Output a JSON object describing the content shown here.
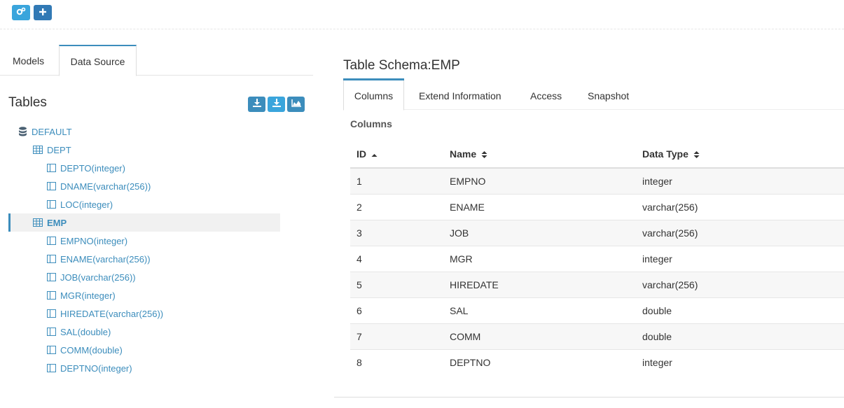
{
  "toolbar": {
    "buttons": [
      "settings-gear-icon",
      "plus-icon"
    ],
    "accent_light": "#3aa5dc",
    "accent_dark": "#3179b5"
  },
  "left": {
    "tabs": [
      "Models",
      "Data Source"
    ],
    "active_tab": "Data Source",
    "tables_title": "Tables",
    "action_icons": [
      "download-icon",
      "download-icon",
      "area-chart-icon"
    ],
    "tree": {
      "root": "DEFAULT",
      "tables": [
        {
          "name": "DEPT",
          "columns": [
            "DEPTO(integer)",
            "DNAME(varchar(256))",
            "LOC(integer)"
          ]
        },
        {
          "name": "EMP",
          "selected": true,
          "columns": [
            "EMPNO(integer)",
            "ENAME(varchar(256))",
            "JOB(varchar(256))",
            "MGR(integer)",
            "HIREDATE(varchar(256))",
            "SAL(double)",
            "COMM(double)",
            "DEPTNO(integer)"
          ]
        }
      ]
    }
  },
  "right": {
    "schema_title": "Table Schema:EMP",
    "tabs": [
      "Columns",
      "Extend Information",
      "Access",
      "Snapshot"
    ],
    "active_tab": "Columns",
    "section_label": "Columns",
    "headers": [
      "ID",
      "Name",
      "Data Type"
    ],
    "rows": [
      [
        "1",
        "EMPNO",
        "integer"
      ],
      [
        "2",
        "ENAME",
        "varchar(256)"
      ],
      [
        "3",
        "JOB",
        "varchar(256)"
      ],
      [
        "4",
        "MGR",
        "integer"
      ],
      [
        "5",
        "HIREDATE",
        "varchar(256)"
      ],
      [
        "6",
        "SAL",
        "double"
      ],
      [
        "7",
        "COMM",
        "double"
      ],
      [
        "8",
        "DEPTNO",
        "integer"
      ]
    ]
  },
  "colors": {
    "link": "#3c8dbc",
    "stripe": "#f7f7f7"
  }
}
